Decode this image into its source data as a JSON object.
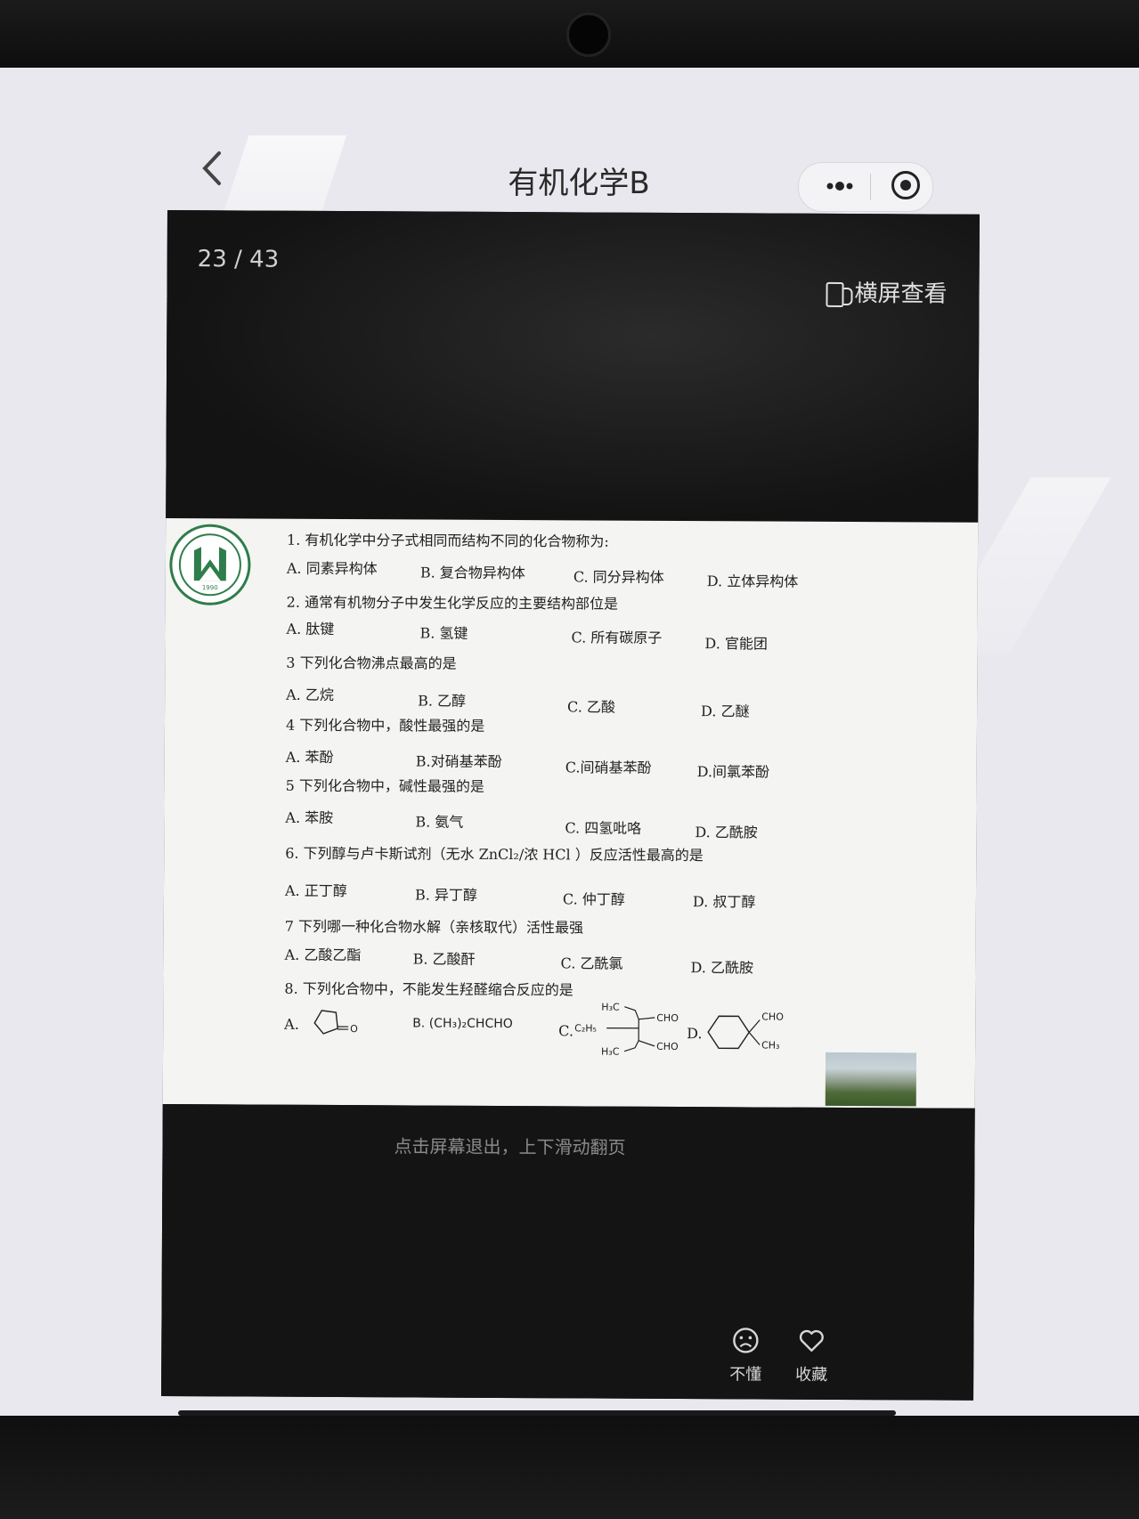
{
  "nav": {
    "back_icon": "chevron-left-icon",
    "title": "有机化学B",
    "more_icon": "more-dots-icon",
    "close_icon": "record-circle-icon"
  },
  "viewer": {
    "page_counter": "23 / 43",
    "landscape_label": "横屏查看",
    "exit_hint": "点击屏幕退出，上下滑动翻页",
    "actions": [
      {
        "label": "不懂",
        "icon": "sad-face-icon"
      },
      {
        "label": "收藏",
        "icon": "heart-icon"
      }
    ]
  },
  "slide": {
    "logo_year": "1990",
    "questions": [
      {
        "text": "1. 有机化学中分子式相同而结构不同的化合物称为:",
        "options": [
          "A. 同素异构体",
          "B. 复合物异构体",
          "C. 同分异构体",
          "D. 立体异构体"
        ]
      },
      {
        "text": "2. 通常有机物分子中发生化学反应的主要结构部位是",
        "options": [
          "A. 肽键",
          "B. 氢键",
          "C. 所有碳原子",
          "D. 官能团"
        ]
      },
      {
        "text": "3 下列化合物沸点最高的是",
        "options": [
          "A. 乙烷",
          "B. 乙醇",
          "C. 乙酸",
          "D. 乙醚"
        ]
      },
      {
        "text": "4 下列化合物中，酸性最强的是",
        "options": [
          "A. 苯酚",
          "B.对硝基苯酚",
          "C.间硝基苯酚",
          "D.间氯苯酚"
        ]
      },
      {
        "text": "5 下列化合物中，碱性最强的是",
        "options": [
          "A. 苯胺",
          "B. 氨气",
          "C. 四氢吡咯",
          "D. 乙酰胺"
        ]
      },
      {
        "text": "6. 下列醇与卢卡斯试剂（无水 ZnCl₂/浓 HCl ）反应活性最高的是",
        "options": [
          "A. 正丁醇",
          "B. 异丁醇",
          "C. 仲丁醇",
          "D. 叔丁醇"
        ]
      },
      {
        "text": "7 下列哪一种化合物水解（亲核取代）活性最强",
        "options": [
          "A. 乙酸乙酯",
          "B. 乙酸酐",
          "C. 乙酰氯",
          "D. 乙酰胺"
        ]
      },
      {
        "text": "8. 下列化合物中，不能发生羟醛缩合反应的是",
        "options": [
          "A.",
          "B. (CH₃)₂CHCHO",
          "C.",
          "D."
        ]
      }
    ],
    "chem_labels": {
      "a_oxygen": "O",
      "c_h3c_top": "H₃C",
      "c_cho_top": "CHO",
      "c_c2h5": "C₂H₅",
      "c_h3c_bottom": "H₃C",
      "c_cho_bottom": "CHO",
      "d_cho": "CHO",
      "d_ch3": "CH₃"
    }
  }
}
